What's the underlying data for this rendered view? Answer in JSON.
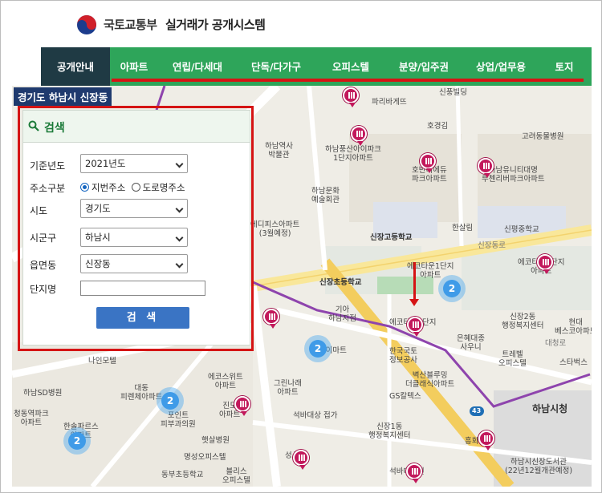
{
  "header": {
    "ministry": "국토교통부",
    "system_title": "실거래가 공개시스템"
  },
  "nav": {
    "items": [
      {
        "label": "공개안내"
      },
      {
        "label": "아파트"
      },
      {
        "label": "연립/다세대"
      },
      {
        "label": "단독/다가구"
      },
      {
        "label": "오피스텔"
      },
      {
        "label": "분양/입주권"
      },
      {
        "label": "상업/업무용"
      },
      {
        "label": "토지"
      }
    ],
    "active": "아파트"
  },
  "map": {
    "location_label": "경기도 하남시 신장동",
    "places": [
      {
        "name": "파리바게뜨"
      },
      {
        "name": "신풍빌딩"
      },
      {
        "name": "호경김"
      },
      {
        "name": "고려동물병원"
      },
      {
        "name": "하남역사\n박물관"
      },
      {
        "name": "하남풍산아이파크\n1단지아파트"
      },
      {
        "name": "호반리에듀\n파크아파트"
      },
      {
        "name": "하남유니티대명\n루첸리버파크아파트"
      },
      {
        "name": "하남문화\n예술회관"
      },
      {
        "name": "신장고등학교"
      },
      {
        "name": "한살림"
      },
      {
        "name": "신평중학교"
      },
      {
        "name": "에디피스아파트\n(3월예정)"
      },
      {
        "name": "에코타운2단지\n아파트"
      },
      {
        "name": "에코타운1단지\n아파트"
      },
      {
        "name": "신장초등학교"
      },
      {
        "name": "기아\n하남지점"
      },
      {
        "name": "에코타운1단지"
      },
      {
        "name": "신장2동\n행정복지센터"
      },
      {
        "name": "현대\n베스코아파트"
      },
      {
        "name": "은혜대종\n사우니"
      },
      {
        "name": "한국국토\n정보공사"
      },
      {
        "name": "트레벨\n오피스텔"
      },
      {
        "name": "스타벅스"
      },
      {
        "name": "나인모텔"
      },
      {
        "name": "e하이마트"
      },
      {
        "name": "벽산블루밍\n더클래식아파트"
      },
      {
        "name": "대동\n피렌체아파트"
      },
      {
        "name": "에코스위트\n아파트"
      },
      {
        "name": "그린나래\n아파트"
      },
      {
        "name": "GS칼텍스"
      },
      {
        "name": "하남SD병원"
      },
      {
        "name": "진도\n아파트"
      },
      {
        "name": "석바대상 접가"
      },
      {
        "name": "하남시청"
      },
      {
        "name": "한솔파르스\n아파트"
      },
      {
        "name": "포인트\n피부과의원"
      },
      {
        "name": "햇살병원"
      },
      {
        "name": "신장1동\n행정복지센터"
      },
      {
        "name": "명성오피스텔"
      },
      {
        "name": "흥화"
      },
      {
        "name": "하남시신장도서관\n(22년12월개관예정)"
      },
      {
        "name": "동부초등학교"
      },
      {
        "name": "블리스\n오피스텔"
      },
      {
        "name": "석바대동신"
      },
      {
        "name": "청동역파크\n아파트"
      },
      {
        "name": "성신"
      }
    ],
    "clusters": [
      {
        "count": "2"
      },
      {
        "count": "2"
      },
      {
        "count": "2"
      },
      {
        "count": "2"
      }
    ],
    "road_labels": [
      {
        "text": "신장동로"
      },
      {
        "text": "대청로"
      },
      {
        "text": "43"
      }
    ]
  },
  "search_panel": {
    "title": "검색",
    "fields": {
      "year_label": "기준년도",
      "year_value": "2021년도",
      "address_type_label": "주소구분",
      "address_option_lot": "지번주소",
      "address_option_road": "도로명주소",
      "address_selected": "지번주소",
      "sido_label": "시도",
      "sido_value": "경기도",
      "sigungu_label": "시군구",
      "sigungu_value": "하남시",
      "dong_label": "읍면동",
      "dong_value": "신장동",
      "complex_label": "단지명",
      "complex_value": ""
    },
    "button_label": "검 색"
  },
  "colors": {
    "nav_green": "#2ea55a",
    "nav_active": "#1f3a44",
    "highlight_red": "#d51414",
    "pin_magenta": "#c2185b",
    "cluster_blue": "#3f9be8",
    "button_blue": "#3a74c4"
  }
}
